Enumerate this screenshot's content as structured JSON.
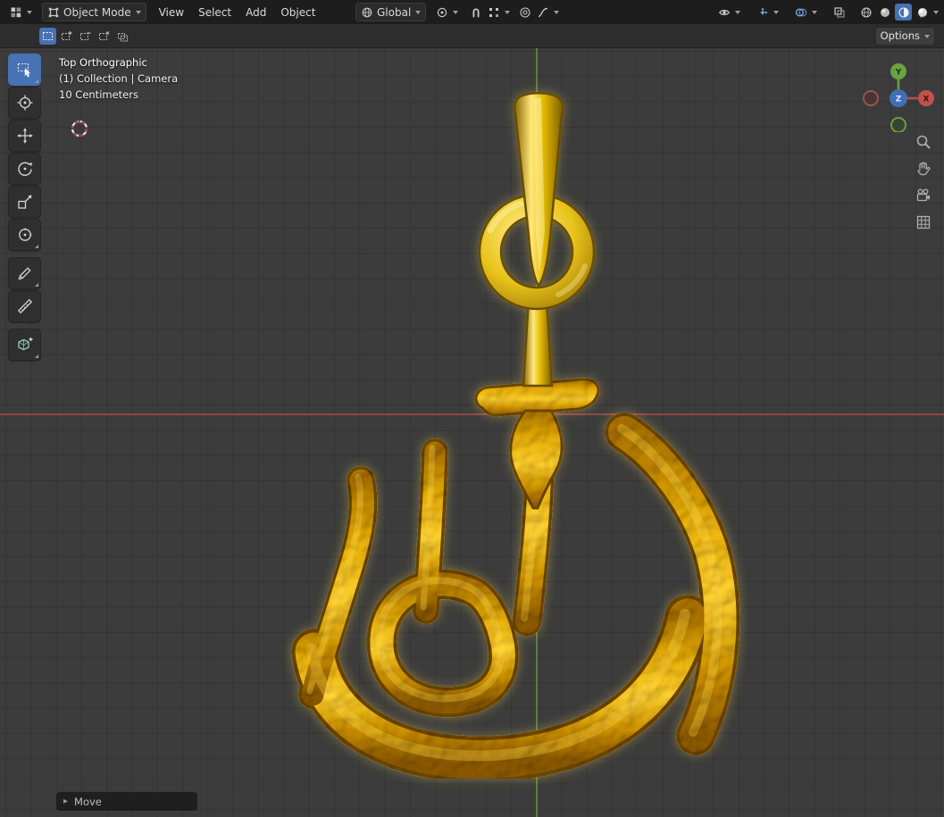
{
  "header": {
    "mode": "Object Mode",
    "menus": [
      "View",
      "Select",
      "Add",
      "Object"
    ],
    "orientation": "Global",
    "options": "Options"
  },
  "tool_settings": {
    "select_modes": [
      "new-selection",
      "extend-selection",
      "subtract-selection",
      "invert-selection",
      "intersect-selection"
    ]
  },
  "toolbar_tools": [
    "select-box",
    "cursor",
    "move",
    "rotate",
    "scale",
    "transform",
    "annotate",
    "measure",
    "add-cube"
  ],
  "viewport": {
    "overlay": [
      "Top Orthographic",
      "(1) Collection | Camera",
      "10 Centimeters"
    ],
    "operator": "Move",
    "axes": {
      "x": "X",
      "y": "Y",
      "z": "Z"
    }
  },
  "colors": {
    "accent": "#4772b3",
    "gold_highlight": "#ffec80",
    "gold_mid": "#e3bb00",
    "gold_shadow": "#7c5c00",
    "axis_x_line": "#9a4a4a",
    "axis_y_line": "#628c3e"
  }
}
